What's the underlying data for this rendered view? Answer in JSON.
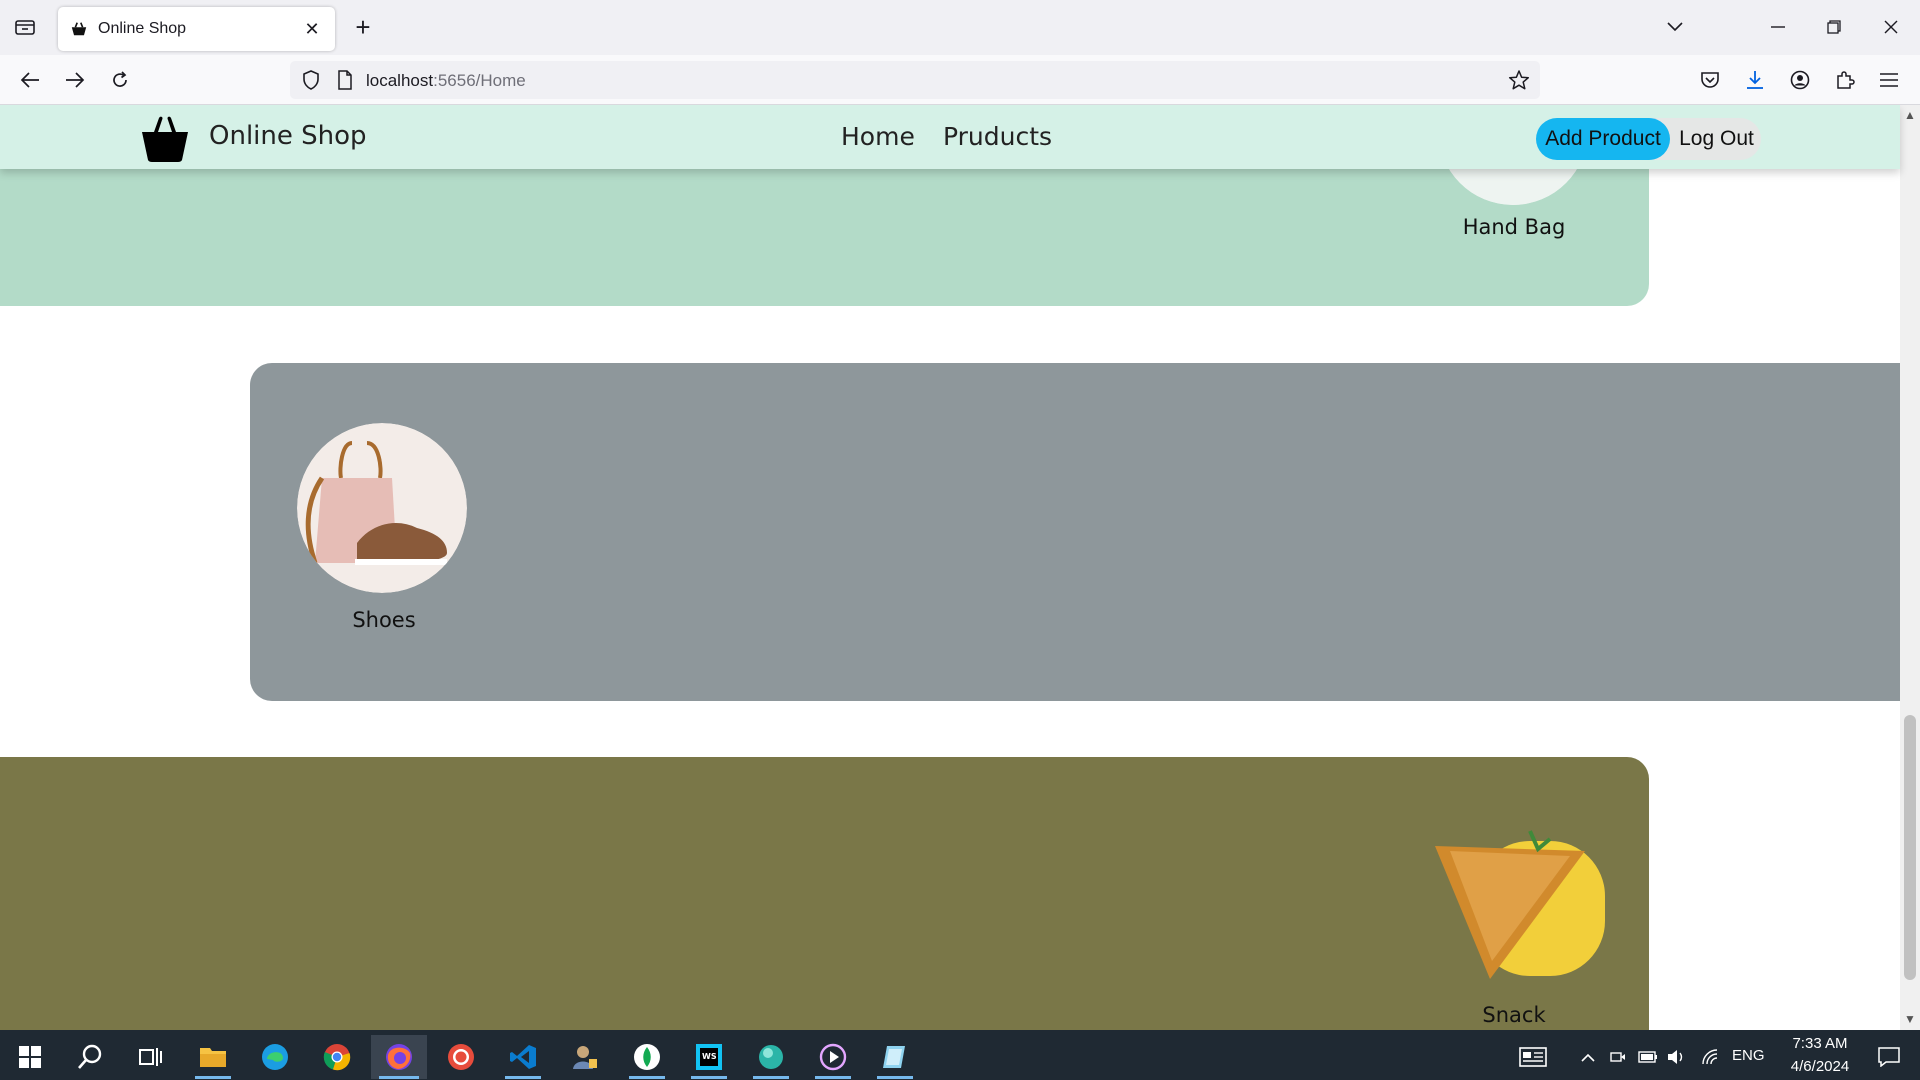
{
  "browser": {
    "tab_title": "Online Shop",
    "url_host": "localhost",
    "url_path": ":5656/Home"
  },
  "site": {
    "logo_text": "Online Shop",
    "nav": [
      "Home",
      "Pruducts"
    ],
    "add_product_label": "Add Product",
    "logout_label": "Log Out"
  },
  "categories": [
    {
      "label": "Hand Bag",
      "band_color": "#b3dbc8"
    },
    {
      "label": "Shoes",
      "band_color": "#8e979b"
    },
    {
      "label": "Snack",
      "band_color": "#7a7748"
    }
  ],
  "taskbar": {
    "language": "ENG",
    "time": "7:33 AM",
    "date": "4/6/2024"
  },
  "colors": {
    "header_bg": "#d5f1e7",
    "accent_button": "#15b6f0",
    "taskbar_bg": "#1f2933"
  }
}
